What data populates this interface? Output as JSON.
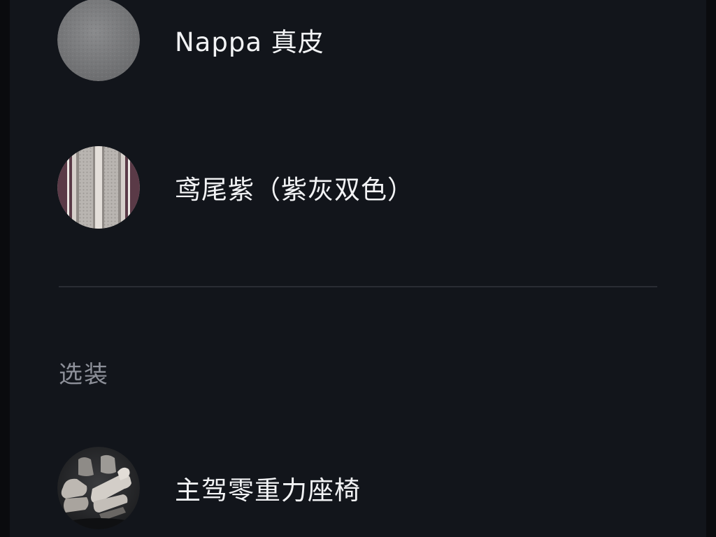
{
  "options": [
    {
      "label": "Nappa 真皮",
      "icon": "leather-grey-swatch-icon"
    },
    {
      "label": "鸢尾紫（紫灰双色）",
      "icon": "iris-purple-grey-swatch-icon"
    }
  ],
  "optional_section": {
    "title": "选装",
    "items": [
      {
        "label": "主驾零重力座椅",
        "icon": "zero-gravity-seat-icon"
      }
    ]
  },
  "colors": {
    "background": "#12151b",
    "text_primary": "#f2f3f5",
    "text_secondary": "#8d9099",
    "divider": "#2a2d34",
    "leather_grey": "#7b7c7e",
    "iris_purple": "#5a3a47",
    "seat_beige": "#cfcac4"
  }
}
